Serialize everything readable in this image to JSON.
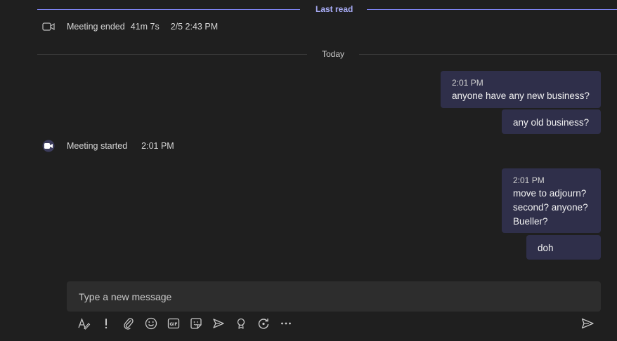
{
  "dividers": {
    "last_read": "Last read",
    "today": "Today"
  },
  "events": {
    "ended": {
      "label": "Meeting ended",
      "duration": "41m 7s",
      "time": "2/5 2:43 PM",
      "icon": "video-camera-icon"
    },
    "started": {
      "label": "Meeting started",
      "time": "2:01 PM",
      "icon": "video-camera-filled-icon"
    }
  },
  "messages": [
    {
      "time": "2:01 PM",
      "lines": [
        "anyone have any new business?"
      ]
    },
    {
      "lines": [
        "any old business?"
      ]
    },
    {
      "time": "2:01 PM",
      "lines": [
        "move to adjourn?",
        "second? anyone?",
        "Bueller?"
      ]
    },
    {
      "lines": [
        "doh"
      ]
    }
  ],
  "composer": {
    "placeholder": "Type a new message"
  },
  "toolbar": {
    "icons": [
      "format-icon",
      "important-icon",
      "attach-icon",
      "emoji-icon",
      "gif-icon",
      "sticker-icon",
      "meet-now-icon",
      "praise-icon",
      "loop-icon",
      "more-options-icon",
      "send-icon"
    ]
  },
  "colors": {
    "background": "#1f1f1f",
    "bubble": "#2f2f4a",
    "accent": "#7f85f5"
  }
}
